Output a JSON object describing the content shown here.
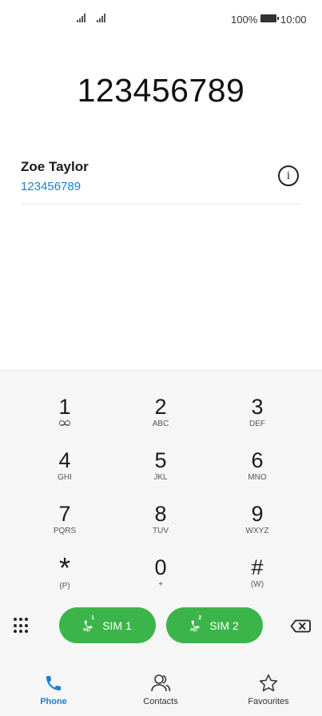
{
  "status_bar": {
    "battery": "100%",
    "time": "10:00"
  },
  "dialer": {
    "number": "123456789"
  },
  "suggestion": {
    "name": "Zoe Taylor",
    "number": "123456789"
  },
  "keypad": {
    "keys": [
      {
        "digit": "1",
        "letters": ""
      },
      {
        "digit": "2",
        "letters": "ABC"
      },
      {
        "digit": "3",
        "letters": "DEF"
      },
      {
        "digit": "4",
        "letters": "GHI"
      },
      {
        "digit": "5",
        "letters": "JKL"
      },
      {
        "digit": "6",
        "letters": "MNO"
      },
      {
        "digit": "7",
        "letters": "PQRS"
      },
      {
        "digit": "8",
        "letters": "TUV"
      },
      {
        "digit": "9",
        "letters": "WXYZ"
      },
      {
        "digit": "*",
        "letters": "(P)"
      },
      {
        "digit": "0",
        "letters": "+"
      },
      {
        "digit": "#",
        "letters": "(W)"
      }
    ]
  },
  "call_buttons": {
    "sim1_label": "SIM 1",
    "sim1_number": "1",
    "sim2_label": "SIM 2",
    "sim2_number": "2",
    "hd": "HD"
  },
  "tabs": [
    {
      "label": "Phone",
      "icon": "phone-icon",
      "active": true
    },
    {
      "label": "Contacts",
      "icon": "contacts-icon",
      "active": false
    },
    {
      "label": "Favourites",
      "icon": "star-icon",
      "active": false
    }
  ],
  "colors": {
    "accent": "#1a7fd6",
    "call_green": "#3bb54a"
  }
}
